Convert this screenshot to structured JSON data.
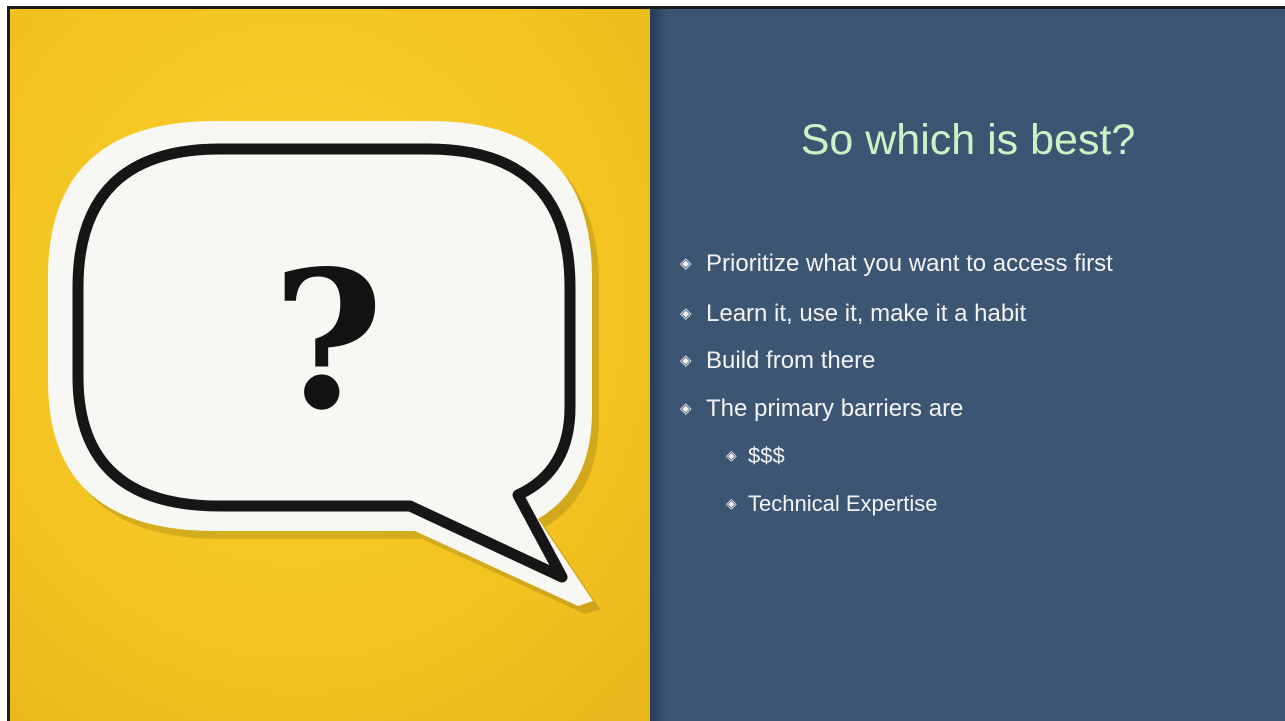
{
  "slide": {
    "title": "So which is best?",
    "bullet_glyph": "◈",
    "sub_bullet_glyph": "◈",
    "bullets": [
      {
        "level": 1,
        "text": "Prioritize what you want to access first"
      },
      {
        "level": 1,
        "text": "Learn it, use it, make it a habit"
      },
      {
        "level": 1,
        "text": "Build from there"
      },
      {
        "level": 1,
        "text": "The primary barriers are"
      },
      {
        "level": 2,
        "text": "$$$"
      },
      {
        "level": 2,
        "text": "Technical Expertise"
      }
    ]
  },
  "image": {
    "symbol": "?",
    "icons": [
      "speech-bubble-icon",
      "question-mark-icon"
    ]
  },
  "colors": {
    "text_panel_bg": "#3c5573",
    "title_text": "#ccf2c6",
    "bullet_text": "#f3f3f3",
    "photo_bg": "#f2c521",
    "bubble_fill": "#f7f7f3",
    "bubble_outline": "#161616"
  }
}
